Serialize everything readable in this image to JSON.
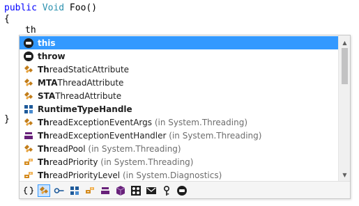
{
  "editor": {
    "line1": {
      "kw": "public",
      "type": "Void",
      "rest": " Foo()"
    },
    "line2": "{",
    "line3": "th",
    "line4": "}"
  },
  "completion": {
    "items": [
      {
        "icon": "keyword-icon",
        "prefix": "this",
        "rest": "",
        "hint": "",
        "selected": true
      },
      {
        "icon": "keyword-icon",
        "prefix": "throw",
        "rest": "",
        "hint": "",
        "selected": false
      },
      {
        "icon": "class-icon",
        "prefix": "Th",
        "rest": "readStaticAttribute",
        "hint": "",
        "selected": false
      },
      {
        "icon": "class-icon",
        "prefix": "MTA",
        "rest": "ThreadAttribute",
        "hint": "",
        "selected": false
      },
      {
        "icon": "class-icon",
        "prefix": "STA",
        "rest": "ThreadAttribute",
        "hint": "",
        "selected": false
      },
      {
        "icon": "struct-icon",
        "prefix": "RuntimeTypeHandle",
        "rest": "",
        "hint": "",
        "selected": false
      },
      {
        "icon": "class-icon",
        "prefix": "Th",
        "rest": "readExceptionEventArgs",
        "hint": " (in System.Threading)",
        "selected": false
      },
      {
        "icon": "delegate-icon",
        "prefix": "Th",
        "rest": "readExceptionEventHandler",
        "hint": " (in System.Threading)",
        "selected": false
      },
      {
        "icon": "class-icon",
        "prefix": "Th",
        "rest": "readPool",
        "hint": " (in System.Threading)",
        "selected": false
      },
      {
        "icon": "enum-icon",
        "prefix": "Th",
        "rest": "readPriority",
        "hint": " (in System.Threading)",
        "selected": false
      },
      {
        "icon": "enum-icon",
        "prefix": "Th",
        "rest": "readPriorityLevel",
        "hint": " (in System.Diagnostics)",
        "selected": false
      }
    ],
    "filters": [
      {
        "icon": "namespace-icon",
        "glyph": "⟨⟩",
        "active": false
      },
      {
        "icon": "class-filter-icon",
        "glyph": "",
        "active": true
      },
      {
        "icon": "interface-icon",
        "glyph": "",
        "active": false
      },
      {
        "icon": "struct-filter-icon",
        "glyph": "",
        "active": false
      },
      {
        "icon": "enum-filter-icon",
        "glyph": "",
        "active": false
      },
      {
        "icon": "delegate-filter-icon",
        "glyph": "",
        "active": false
      },
      {
        "icon": "module-icon",
        "glyph": "",
        "active": false
      },
      {
        "icon": "member-icon",
        "glyph": "",
        "active": false
      },
      {
        "icon": "event-icon",
        "glyph": "",
        "active": false
      },
      {
        "icon": "key-icon",
        "glyph": "",
        "active": false
      },
      {
        "icon": "keyword-filter-icon",
        "glyph": "",
        "active": false
      }
    ],
    "scroll_up": "▲",
    "scroll_down": "▼"
  },
  "colors": {
    "selection": "#3399ff",
    "class_orange": "#c27d1a",
    "struct_blue": "#1e5a9a",
    "delegate_purple": "#68217a",
    "enum_orange": "#d48b1e"
  }
}
